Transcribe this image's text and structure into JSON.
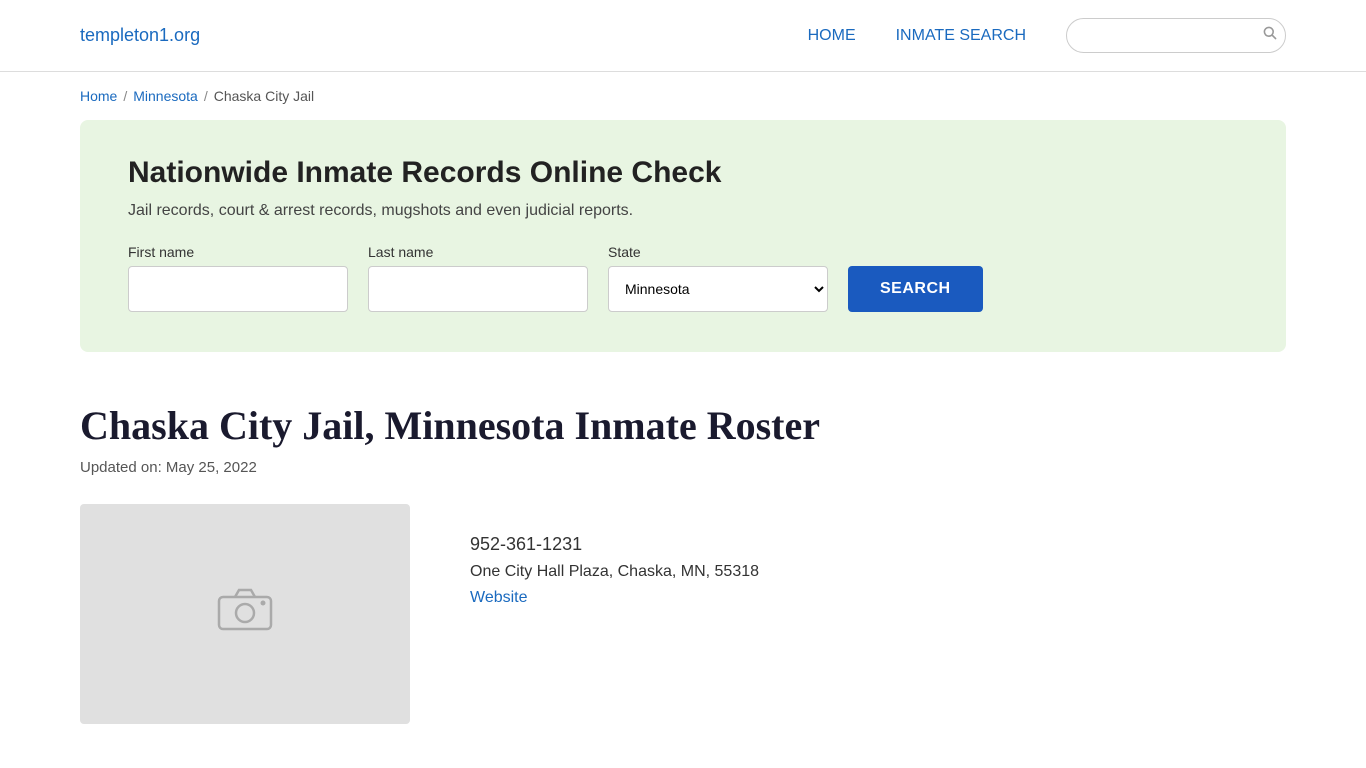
{
  "header": {
    "logo": "templeton1.org",
    "nav": [
      {
        "label": "HOME",
        "id": "home"
      },
      {
        "label": "INMATE SEARCH",
        "id": "inmate-search"
      }
    ],
    "search_placeholder": ""
  },
  "breadcrumb": {
    "items": [
      {
        "label": "Home",
        "link": true
      },
      {
        "label": "Minnesota",
        "link": true
      },
      {
        "label": "Chaska City Jail",
        "link": false
      }
    ]
  },
  "banner": {
    "title": "Nationwide Inmate Records Online Check",
    "subtitle": "Jail records, court & arrest records, mugshots and even judicial reports.",
    "form": {
      "first_name_label": "First name",
      "last_name_label": "Last name",
      "state_label": "State",
      "state_value": "Minnesota",
      "search_button": "SEARCH"
    }
  },
  "page": {
    "title": "Chaska City Jail, Minnesota Inmate Roster",
    "updated": "Updated on: May 25, 2022",
    "phone": "952-361-1231",
    "address": "One City Hall Plaza, Chaska, MN, 55318",
    "website_label": "Website"
  }
}
